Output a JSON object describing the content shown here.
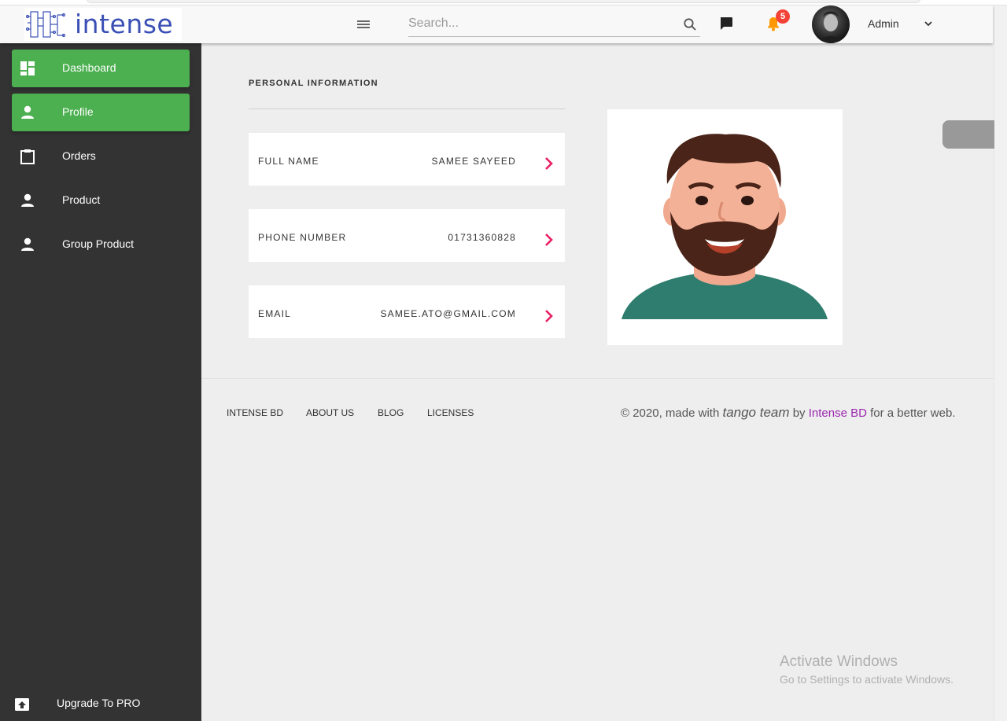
{
  "header": {
    "logo_text": "intense",
    "search_placeholder": "Search...",
    "notification_count": "5",
    "user_name": "Admin"
  },
  "sidebar": {
    "items": [
      {
        "label": "Dashboard",
        "icon": "dashboard-icon",
        "active": true
      },
      {
        "label": "Profile",
        "icon": "person-icon",
        "active": true
      },
      {
        "label": "Orders",
        "icon": "clipboard-icon",
        "active": false
      },
      {
        "label": "Product",
        "icon": "person-icon",
        "active": false
      },
      {
        "label": "Group Product",
        "icon": "person-icon",
        "active": false
      }
    ],
    "upgrade_label": "Upgrade To PRO"
  },
  "profile": {
    "section_title": "PERSONAL INFORMATION",
    "fields": [
      {
        "label": "FULL NAME",
        "value": "SAMEE SAYEED"
      },
      {
        "label": "PHONE NUMBER",
        "value": "01731360828"
      },
      {
        "label": "EMAIL",
        "value": "SAMEE.ATO@GMAIL.COM"
      }
    ]
  },
  "footer": {
    "links": [
      "INTENSE BD",
      "ABOUT US",
      "BLOG",
      "LICENSES"
    ],
    "copyright_prefix": "© 2020, made with ",
    "copyright_tango": "tango team",
    "copyright_by": " by ",
    "copyright_brand": "Intense BD",
    "copyright_suffix": " for a better web."
  },
  "watermark": {
    "title": "Activate Windows",
    "subtitle": "Go to Settings to activate Windows."
  },
  "colors": {
    "sidebar_bg": "#333333",
    "active_green": "#4caf50",
    "accent_pink": "#e91e63",
    "badge_red": "#f44336",
    "brand_purple": "#9c27b0"
  }
}
